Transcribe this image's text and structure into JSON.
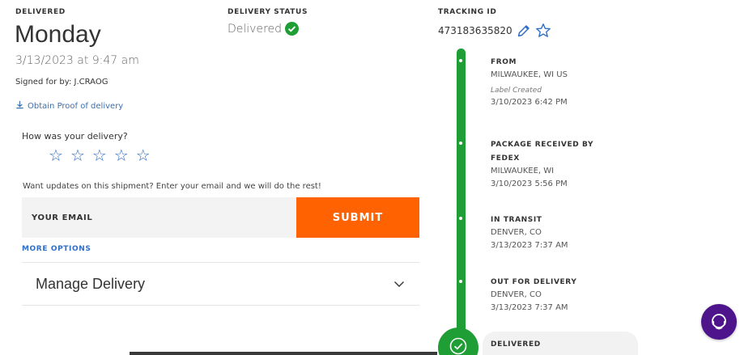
{
  "delivered": {
    "label": "DELIVERED",
    "day": "Monday",
    "datetime": "3/13/2023 at 9:47 am",
    "signed_for": "Signed for by: J.CRAOG",
    "proof_link": "Obtain Proof of delivery"
  },
  "status": {
    "label": "DELIVERY STATUS",
    "value": "Delivered",
    "check_color": "#1f9e35"
  },
  "tracking": {
    "label": "TRACKING ID",
    "number": "473183635820",
    "edit_icon": "pencil-icon",
    "favorite_icon": "star-outline-icon"
  },
  "rating": {
    "question": "How was your delivery?",
    "stars": 5,
    "selected": 0
  },
  "updates": {
    "text": "Want updates on this shipment? Enter your email and we will do the rest!",
    "email_placeholder": "YOUR EMAIL",
    "submit_label": "SUBMIT",
    "more_options": "MORE OPTIONS"
  },
  "manage": {
    "label": "Manage Delivery"
  },
  "timeline": {
    "events": [
      {
        "title": "FROM",
        "lines": [
          "MILWAUKEE, WI US"
        ],
        "note": "Label Created",
        "time": "3/10/2023 6:42 PM"
      },
      {
        "title": "PACKAGE RECEIVED BY",
        "title2": "FEDEX",
        "lines": [
          "MILWAUKEE, WI"
        ],
        "time": "3/10/2023 5:56 PM"
      },
      {
        "title": "IN TRANSIT",
        "lines": [
          "DENVER, CO"
        ],
        "time": "3/13/2023 7:37 AM"
      },
      {
        "title": "OUT FOR DELIVERY",
        "lines": [
          "DENVER, CO"
        ],
        "time": "3/13/2023 7:37 AM"
      },
      {
        "title": "DELIVERED"
      }
    ]
  },
  "colors": {
    "accent_orange": "#ff6200",
    "link_blue": "#2f6ec7",
    "timeline_green": "#1f9e35",
    "chat_purple": "#4d148c"
  }
}
